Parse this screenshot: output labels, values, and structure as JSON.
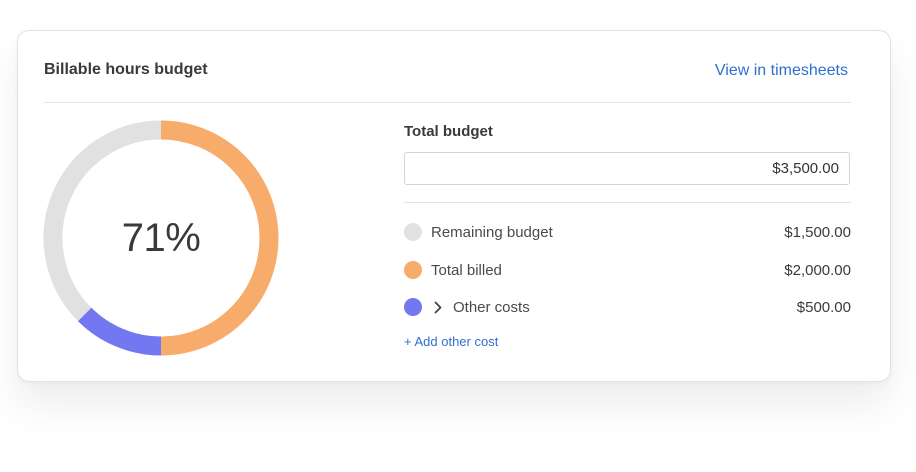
{
  "card": {
    "title": "Billable hours budget",
    "link_label": "View in timesheets"
  },
  "donut": {
    "percent_label": "71%",
    "segments": [
      {
        "name": "Total billed",
        "value": 2000,
        "color": "#f8ac6c"
      },
      {
        "name": "Other costs",
        "value": 500,
        "color": "#7478f0"
      },
      {
        "name": "Remaining budget",
        "value": 1500,
        "color": "#e1e1e1"
      }
    ]
  },
  "budget": {
    "total_label": "Total budget",
    "total_value": "$3,500.00"
  },
  "breakdown": [
    {
      "label": "Remaining budget",
      "amount": "$1,500.00",
      "color": "#e1e1e1"
    },
    {
      "label": "Total billed",
      "amount": "$2,000.00",
      "color": "#f8ac6c"
    },
    {
      "label": "Other costs",
      "amount": "$500.00",
      "color": "#7478f0"
    }
  ],
  "actions": {
    "add_other_cost": "+ Add other cost"
  }
}
